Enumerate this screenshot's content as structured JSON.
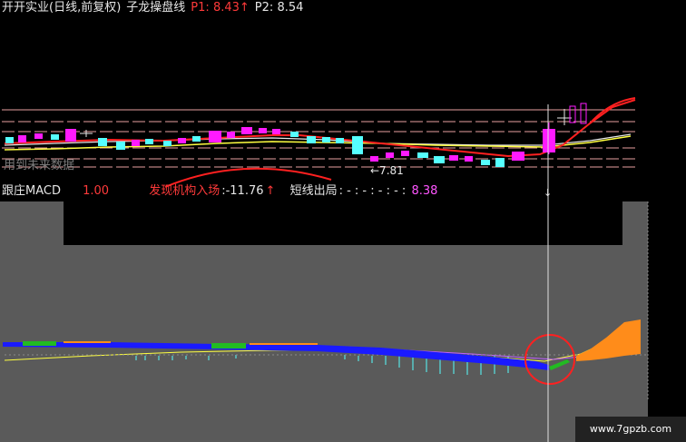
{
  "header": {
    "title": "开开实业(日线,前复权)",
    "indicator_name": "子龙操盘线",
    "p1_label": "P1:",
    "p1_value": "8.43",
    "p1_arrow": "↑",
    "p2_label": "P2:",
    "p2_value": "8.54"
  },
  "main_chart": {
    "future_data_text": "用到未来数据",
    "low_marker": "←7.81",
    "cursor_arrow": "↓"
  },
  "indicator_bar": {
    "name": "跟庄MACD",
    "value1": "1.00",
    "label2": "发现机构入场",
    "value2": ":-11.76",
    "arrow2": "↑",
    "label3": "短线出局",
    "dots": ": - : -  : - : - :",
    "value3": "8.38"
  },
  "colors": {
    "up_candle": "#ff1aff",
    "down_candle": "#55ffff",
    "ma_red": "#ff2020",
    "ma_yellow": "#ffff40",
    "ma_white": "#e8e8e8",
    "hline": "#e8a0a0",
    "blue_band": "#1a1aff",
    "orange_band": "#ff8c1a",
    "panel_gray": "#5a5a5a"
  },
  "watermark": "www.7gpzb.com"
}
